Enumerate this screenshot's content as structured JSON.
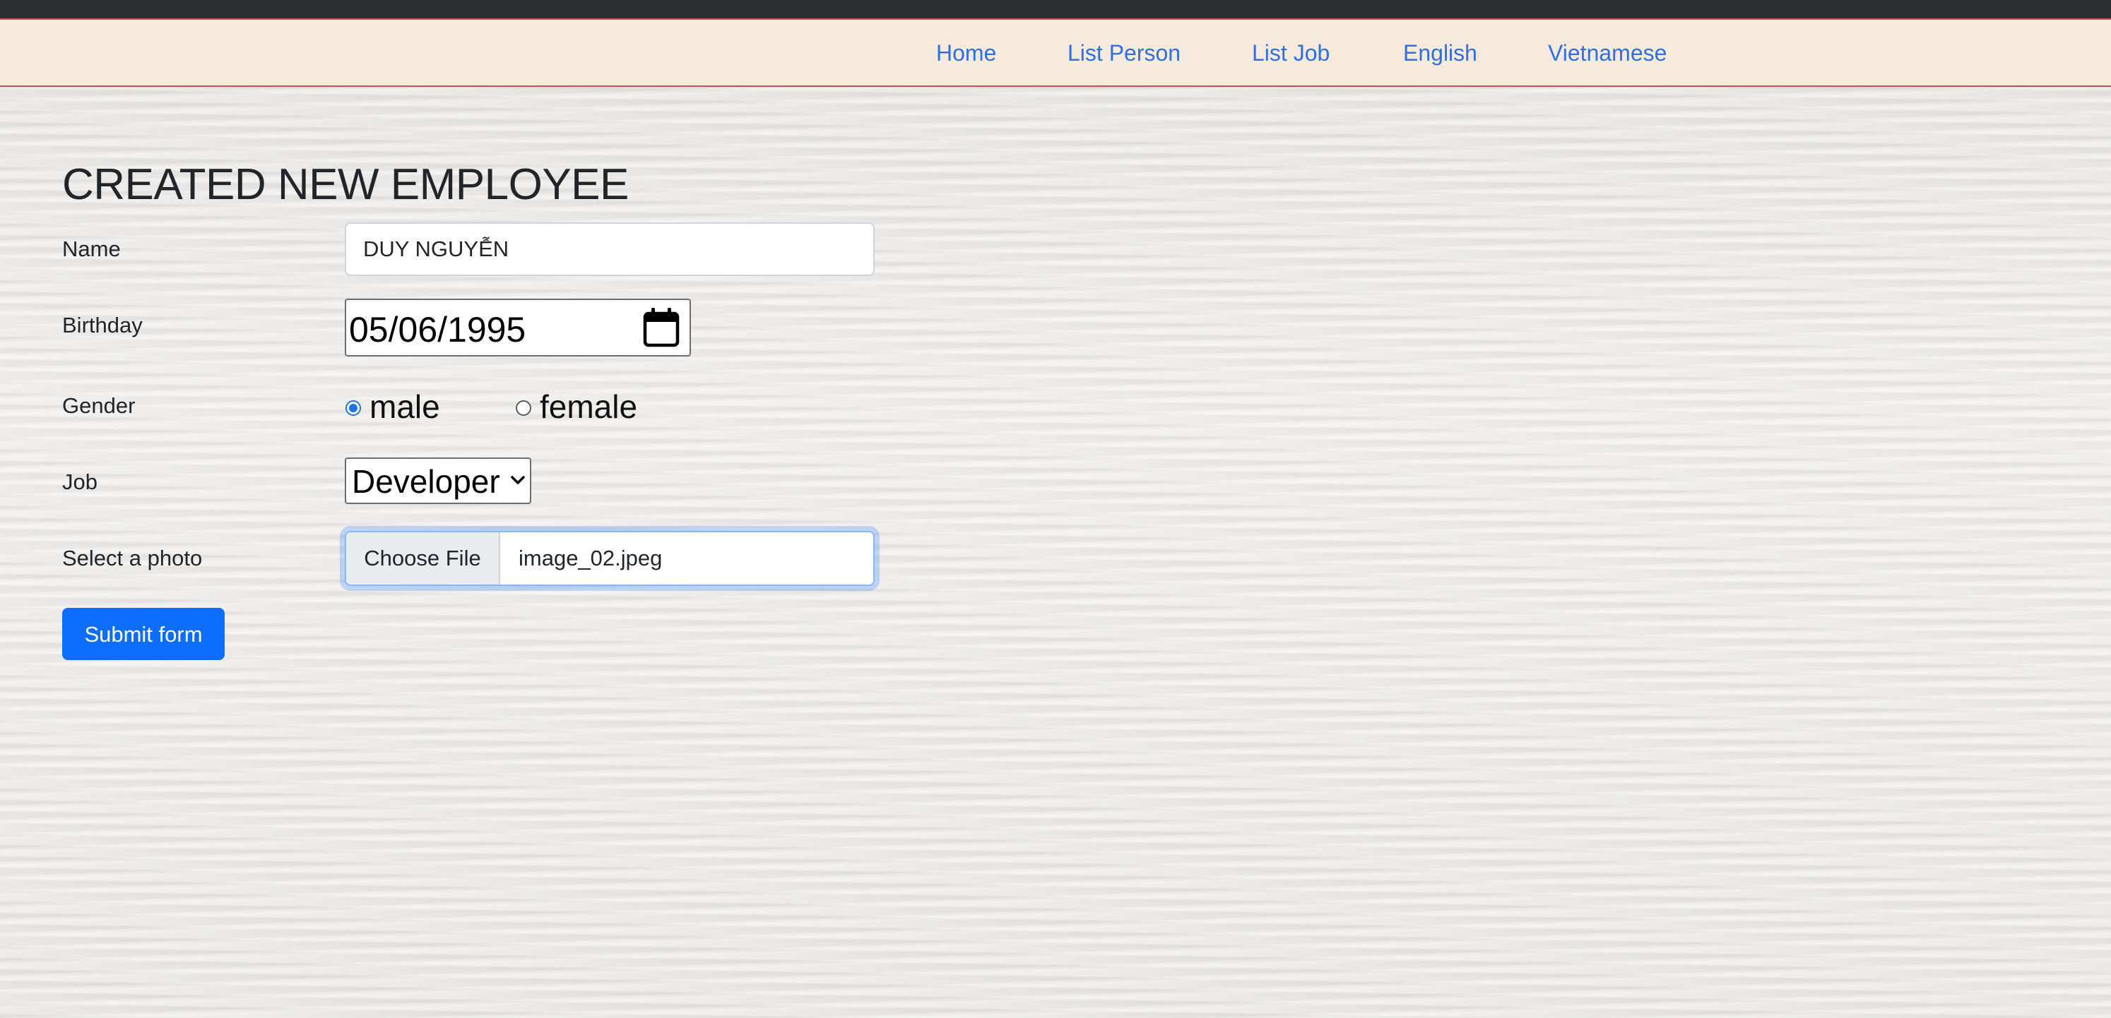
{
  "nav": {
    "links": [
      {
        "label": "Home"
      },
      {
        "label": "List Person"
      },
      {
        "label": "List Job"
      },
      {
        "label": "English"
      },
      {
        "label": "Vietnamese"
      }
    ]
  },
  "form": {
    "title": "CREATED NEW EMPLOYEE",
    "name": {
      "label": "Name",
      "value": "DUY NGUYỄN"
    },
    "birthday": {
      "label": "Birthday",
      "value": "05/06/1995"
    },
    "gender": {
      "label": "Gender",
      "options": [
        {
          "label": "male",
          "checked": true
        },
        {
          "label": "female",
          "checked": false
        }
      ]
    },
    "job": {
      "label": "Job",
      "selected": "Developer"
    },
    "photo": {
      "label": "Select a photo",
      "button_label": "Choose File",
      "file_name": "image_02.jpeg"
    },
    "submit_label": "Submit form"
  },
  "colors": {
    "nav_background": "#f5eadb",
    "nav_border": "#d64b4b",
    "link": "#2f6fe0",
    "primary": "#0d6efd"
  },
  "icons": {
    "date_picker": "calendar-icon",
    "select": "chevron-down-icon"
  }
}
